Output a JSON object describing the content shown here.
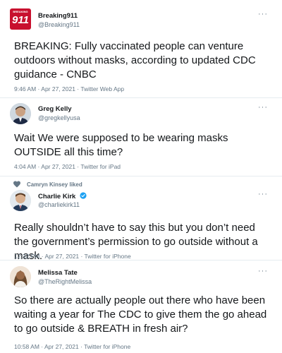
{
  "tweets": [
    {
      "name": "Breaking911",
      "handle": "@Breaking911",
      "avatar_label": "911",
      "avatar_top_text": "BREAKING",
      "text": "BREAKING: Fully vaccinated people can venture outdoors without masks, according to updated CDC guidance - CNBC",
      "meta": "9:46 AM · Apr 27, 2021 · Twitter Web App",
      "more": "···"
    },
    {
      "name": "Greg Kelly",
      "handle": "@gregkellyusa",
      "text": "Wait We were supposed to be wearing masks OUTSIDE all this time?",
      "meta": "4:04 AM · Apr 27, 2021 · Twitter for iPad",
      "more": "···"
    },
    {
      "liked_by": "Camryn Kinsey liked",
      "name": "Charlie Kirk",
      "handle": "@charliekirk11",
      "verified": true,
      "text": "Really shouldn’t have to say this but you don’t need the government’s permission to go outside without a mask.",
      "meta": "12:32 PM · Apr 27, 2021 · Twitter for iPhone",
      "more": "···"
    },
    {
      "name": "Melissa Tate",
      "handle": "@TheRightMelissa",
      "text": "So there are actually people out there who have been waiting a year for The CDC to give them the go ahead to go outside & BREATH in fresh air?",
      "meta": "10:58 AM · Apr 27, 2021 · Twitter for iPhone",
      "more": "···"
    }
  ],
  "colors": {
    "breaking_red": "#c8102e",
    "verified_blue": "#1da1f2",
    "heart_gray": "#657786",
    "separator": "#e6ecf0"
  }
}
